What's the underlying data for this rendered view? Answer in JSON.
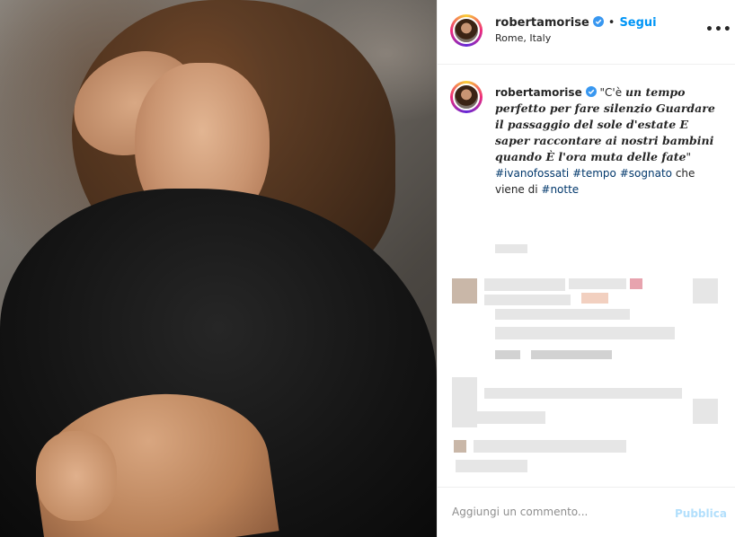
{
  "header": {
    "username": "robertamorise",
    "separator": "•",
    "follow_label": "Segui",
    "location": "Rome, Italy",
    "more_label": "•••"
  },
  "caption": {
    "username": "robertamorise",
    "open_quote": "\"C'è ",
    "poem": "un tempo perfetto per fare silenzio Guardare il passaggio del sole d'estate E saper raccontare ai nostri bambini quando È l'ora muta delle fate",
    "close_quote": "\"",
    "hashtags": [
      "#ivanofossati",
      "#tempo",
      "#sognato"
    ],
    "text_middle": " che viene di ",
    "hashtag_last": "#notte"
  },
  "footer": {
    "comment_placeholder": "Aggiungi un commento...",
    "publish_label": "Pubblica"
  },
  "colors": {
    "accent": "#0095f6",
    "hashtag": "#00376b",
    "publish_disabled": "#b2dffc",
    "border": "#efefef"
  },
  "icons": {
    "verified": "verified-badge-icon",
    "more": "more-options-icon"
  }
}
